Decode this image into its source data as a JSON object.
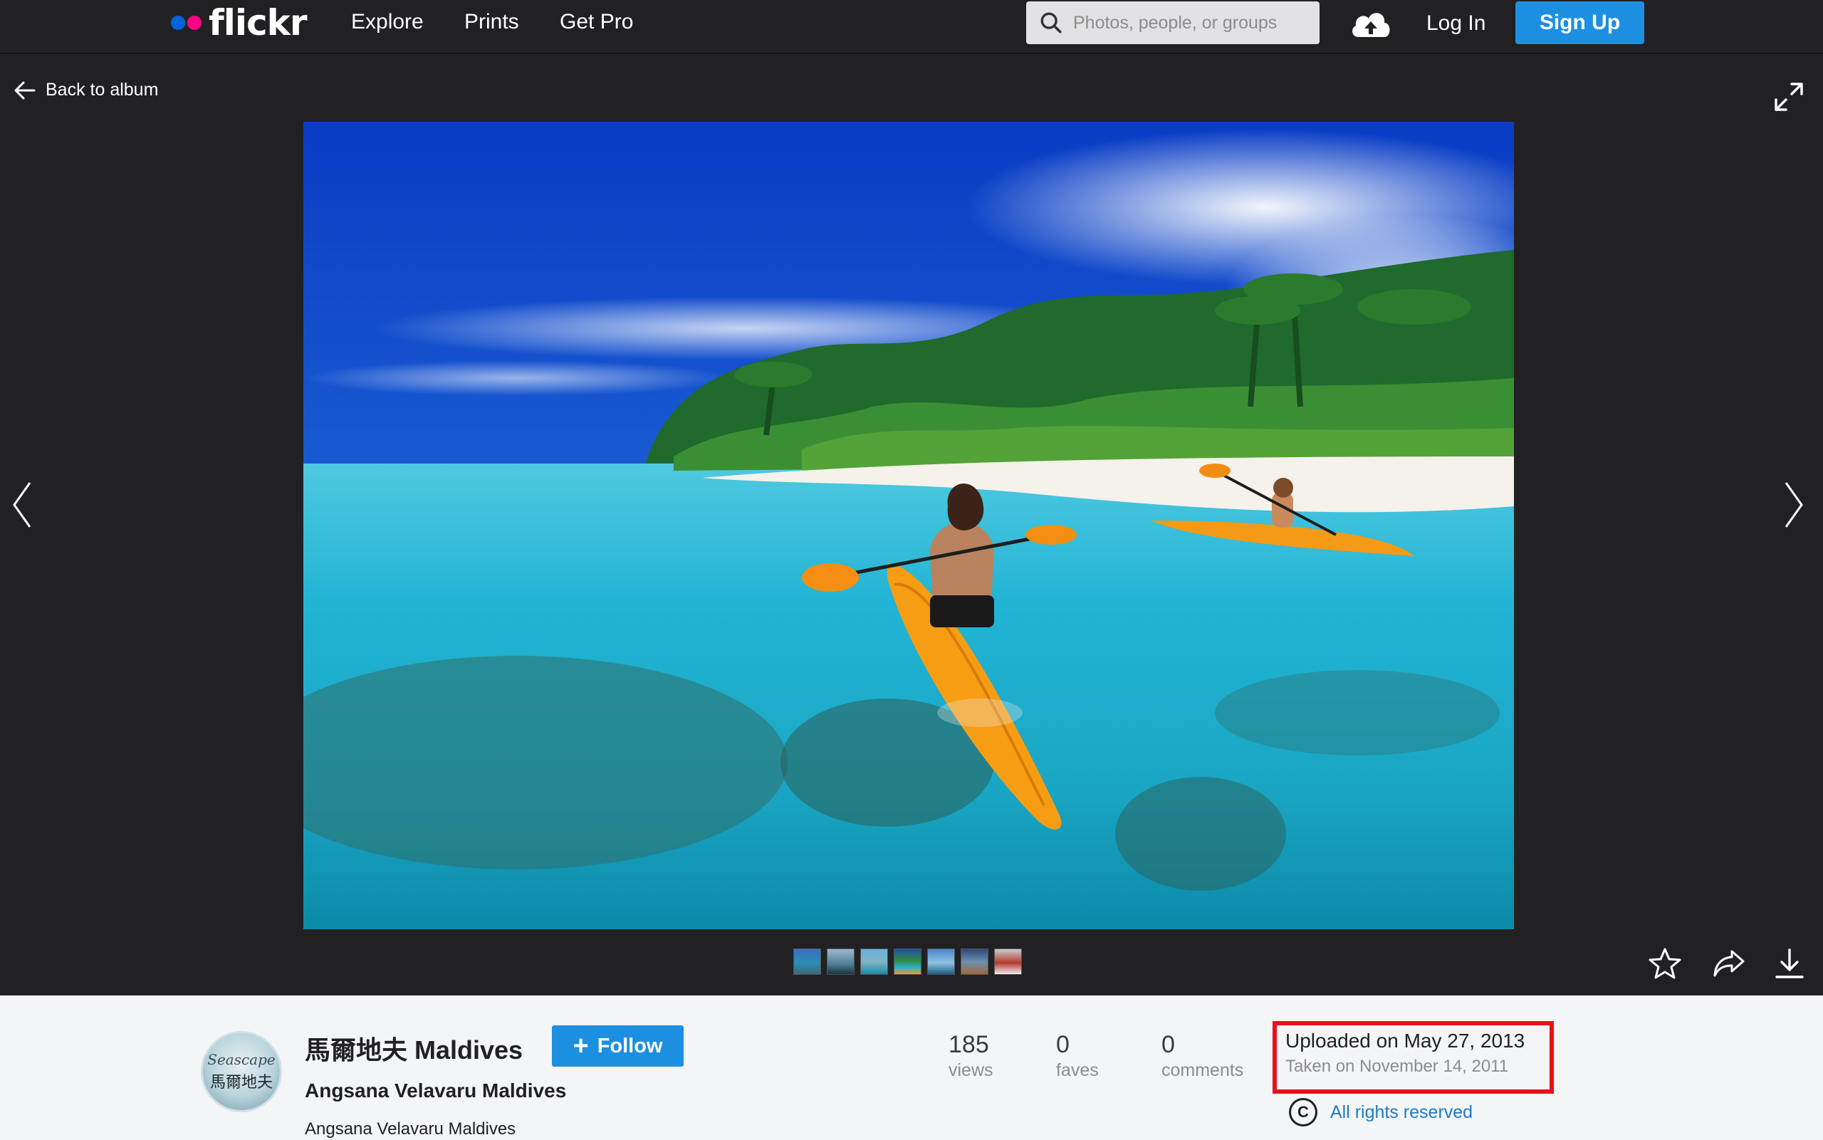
{
  "nav": {
    "logo": "flickr",
    "links": [
      "Explore",
      "Prints",
      "Get Pro"
    ],
    "search_placeholder": "Photos, people, or groups",
    "login": "Log In",
    "signup": "Sign Up"
  },
  "viewer": {
    "back_label": "Back to album",
    "thumbnail_count": 7
  },
  "owner": {
    "name": "馬爾地夫 Maldives",
    "follow_label": "Follow",
    "avatar_text_top": "Seascape",
    "avatar_text_bottom": "馬爾地夫"
  },
  "photo": {
    "title": "Angsana Velavaru Maldives",
    "description": "Angsana Velavaru Maldives"
  },
  "stats": [
    {
      "value": "185",
      "label": "views"
    },
    {
      "value": "0",
      "label": "faves"
    },
    {
      "value": "0",
      "label": "comments"
    }
  ],
  "dates": {
    "uploaded": "Uploaded on May 27, 2013",
    "taken": "Taken on November 14, 2011"
  },
  "license": {
    "symbol": "C",
    "text": "All rights reserved"
  },
  "colors": {
    "accent": "#1c8fe0",
    "highlight_box": "#e8101a",
    "nav_bg": "#212124",
    "panel_bg": "#f4f5f7"
  }
}
